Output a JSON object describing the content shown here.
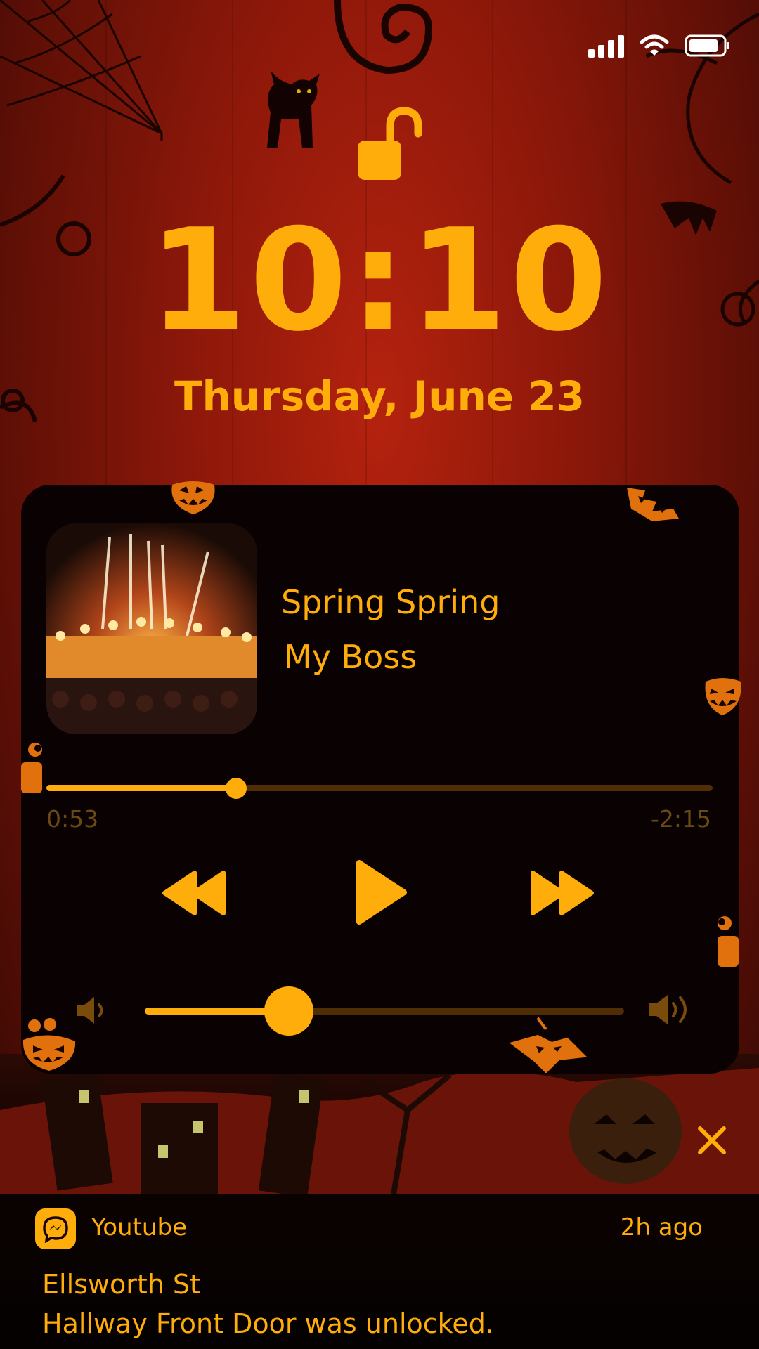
{
  "colors": {
    "accent": "#ffad0a",
    "card": "#0a0102",
    "track": "#4f2e05",
    "muted": "#6a4a12"
  },
  "status_bar": {
    "signal_icon": "signal-bars-icon",
    "wifi_icon": "wifi-icon",
    "battery_icon": "battery-icon"
  },
  "lock_screen": {
    "lock_icon": "unlocked-padlock-icon",
    "time": "10:10",
    "date": "Thursday, June 23"
  },
  "player": {
    "title": "Spring Spring",
    "artist": "My Boss",
    "elapsed": "0:53",
    "remaining": "-2:15",
    "progress_fraction": 0.285,
    "volume_fraction": 0.3,
    "controls": [
      "rewind-icon",
      "play-icon",
      "fast-forward-icon"
    ],
    "volume_icons": [
      "volume-low-icon",
      "volume-high-icon"
    ]
  },
  "notification": {
    "app_icon": "messenger-icon",
    "app": "Youtube",
    "time": "2h ago",
    "title": "Ellsworth St",
    "body": "Hallway Front Door was unlocked."
  },
  "close_icon": "close-icon"
}
